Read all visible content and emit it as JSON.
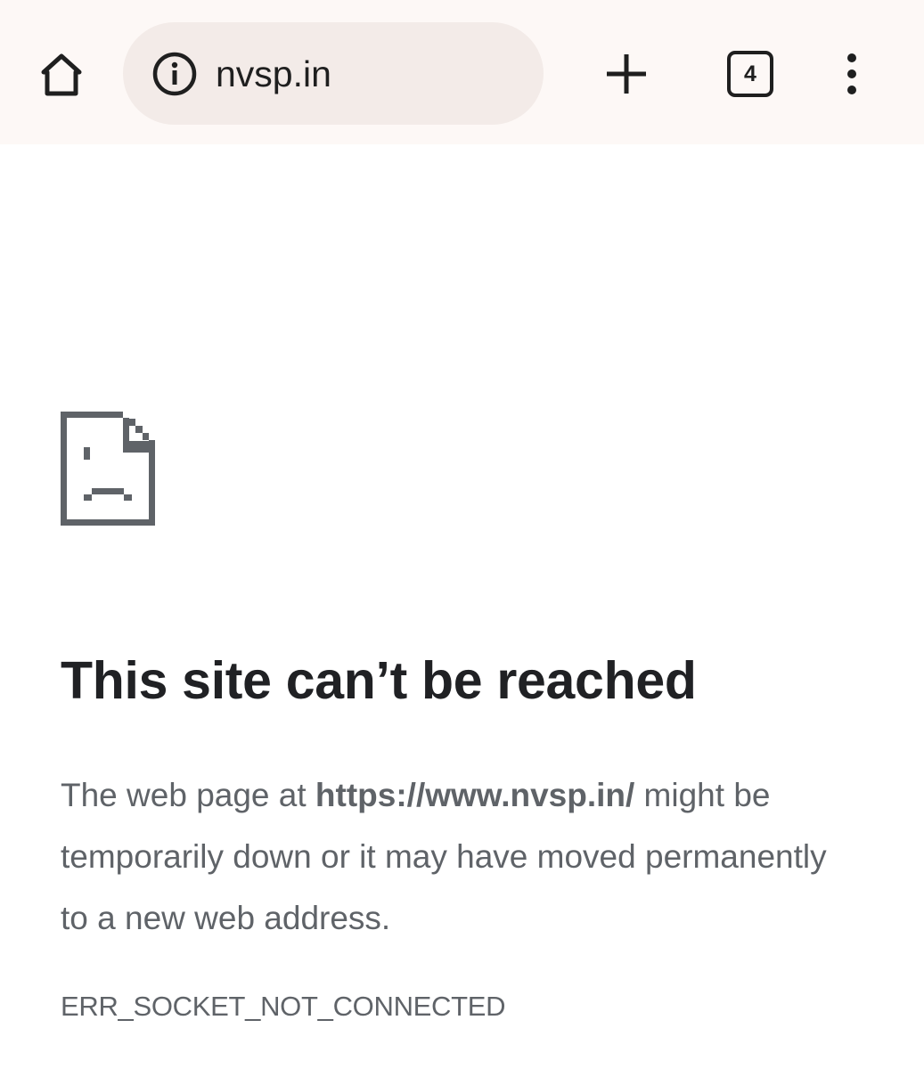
{
  "toolbar": {
    "home_icon": "home-icon",
    "url": "nvsp.in",
    "site_info_icon": "info-icon",
    "new_tab_icon": "plus-icon",
    "tab_count": "4",
    "menu_icon": "more-vert-icon"
  },
  "error": {
    "icon": "sad-page-icon",
    "title": "This site can’t be reached",
    "message_before": "The web page at ",
    "message_url": "https://www.nvsp.in/",
    "message_after": " might be temporarily down or it may have moved permanently to a new web address.",
    "code": "ERR_SOCKET_NOT_CONNECTED"
  },
  "colors": {
    "toolbar_bg": "#fdf8f6",
    "omnibox_bg": "#f3ebe8",
    "heading": "#202124",
    "body_text": "#5f6368",
    "icon": "#1f1f1f",
    "error_icon": "#5f6368"
  }
}
